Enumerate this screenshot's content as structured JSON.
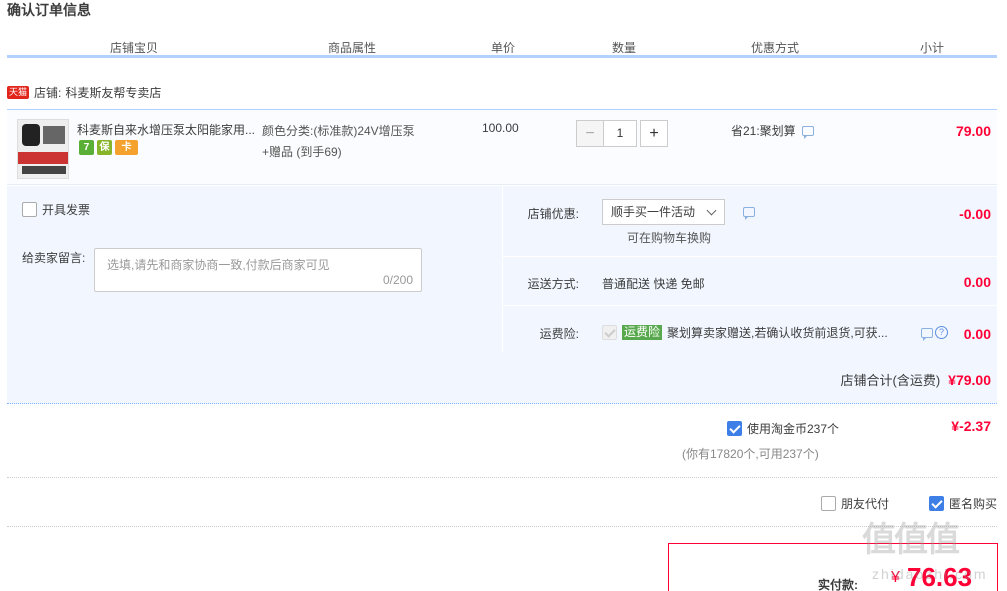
{
  "page_title": "确认订单信息",
  "columns": [
    "店铺宝贝",
    "商品属性",
    "单价",
    "数量",
    "优惠方式",
    "小计"
  ],
  "shop": {
    "badge": "天猫",
    "label": "店铺:",
    "name": "科麦斯友帮专卖店"
  },
  "item": {
    "title": "科麦斯自来水增压泵太阳能家用...",
    "service_icons": [
      "7",
      "保",
      "卡"
    ],
    "attr_line1": "颜色分类:(标准款)24V增压泵",
    "attr_line2": "+赠品 (到手69)",
    "price": "100.00",
    "quantity": "1",
    "qty_minus": "−",
    "qty_plus": "+",
    "promo": "省21:聚划算",
    "subtotal": "79.00"
  },
  "invoice_label": "开具发票",
  "message": {
    "label": "给卖家留言:",
    "placeholder": "选填,请先和商家协商一致,付款后商家可见",
    "counter": "0/200"
  },
  "shop_discount": {
    "label": "店铺优惠:",
    "selected": "顺手买一件活动",
    "sub": "可在购物车换购",
    "value": "-0.00"
  },
  "shipping": {
    "label": "运送方式:",
    "value_text": "普通配送 快递 免邮",
    "value": "0.00"
  },
  "insurance": {
    "label": "运费险:",
    "tag": "运费险",
    "text": "聚划算卖家赠送,若确认收货前退货,可获...",
    "help": "?",
    "value": "0.00"
  },
  "shop_total": {
    "label": "店铺合计(含运费)",
    "value": "¥79.00"
  },
  "coins": {
    "label": "使用淘金币237个",
    "sub": "(你有17820个,可用237个)",
    "value": "¥-2.37"
  },
  "friend_pay": "朋友代付",
  "anonymous": "匿名购买",
  "final": {
    "label": "实付款:",
    "currency": "¥",
    "value": "76.63"
  },
  "watermark": {
    "logo": "值值值",
    "site": "zhidaozhi.com"
  },
  "colors": {
    "accent": "#ff0036",
    "blue": "#3d7fe6",
    "header_line": "#b2d1ff",
    "panel_bg": "#f2f7ff"
  }
}
